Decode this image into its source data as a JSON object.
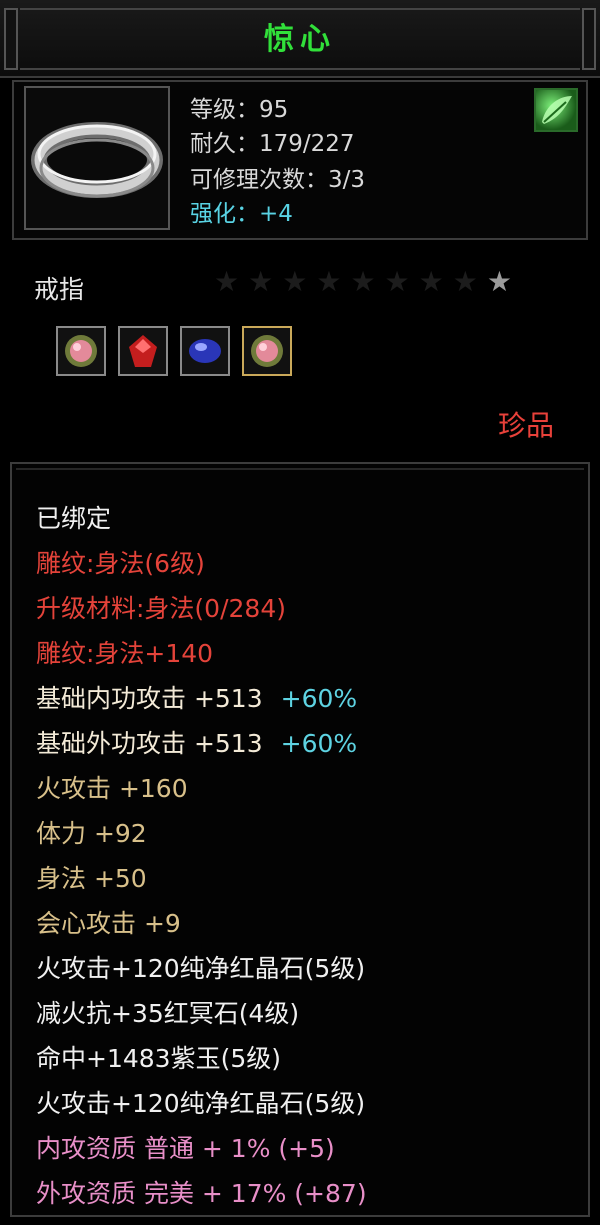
{
  "title": "惊心",
  "header": {
    "level": "等级：95",
    "durability": "耐久：179/227",
    "repairs": "可修理次数：3/3",
    "enhance": "强化：+4",
    "icon": "ring-icon",
    "badge_icon": "green-leaf-icon"
  },
  "item_type": "戒指",
  "stars": {
    "total": 9,
    "lit": 1
  },
  "gems": [
    {
      "icon": "pink-gem-icon",
      "color": "#e06a8a"
    },
    {
      "icon": "red-gem-icon",
      "color": "#d82a2a"
    },
    {
      "icon": "blue-gem-icon",
      "color": "#4a5ad8"
    },
    {
      "icon": "pink-gem-icon",
      "color": "#e06a8a"
    }
  ],
  "rarity": "珍品",
  "attributes": {
    "bound": "已绑定",
    "engrave": "雕纹:身法(6级)",
    "upgrade_mat": "升级材料:身法(0/284)",
    "engrave_bonus": "雕纹:身法+140",
    "inner_atk": "基础内功攻击 +513",
    "inner_atk_pct": "+60%",
    "outer_atk": "基础外功攻击 +513",
    "outer_atk_pct": "+60%",
    "fire_atk": "火攻击 +160",
    "stamina": "体力 +92",
    "agility": "身法 +50",
    "crit": "会心攻击 +9",
    "gem1": "火攻击+120纯净红晶石(5级)",
    "gem2": "减火抗+35红冥石(4级)",
    "gem3": "命中+1483紫玉(5级)",
    "gem4": "火攻击+120纯净红晶石(5级)",
    "inner_quality": "内攻资质 普通 + 1% (+5)",
    "outer_quality": "外攻资质 完美 + 17% (+87)"
  },
  "colors": {
    "title": "#31e03a",
    "red": "#e4433a",
    "gold": "#d8c08a",
    "pink": "#e88fc8",
    "cyan": "#5ed3e2"
  }
}
